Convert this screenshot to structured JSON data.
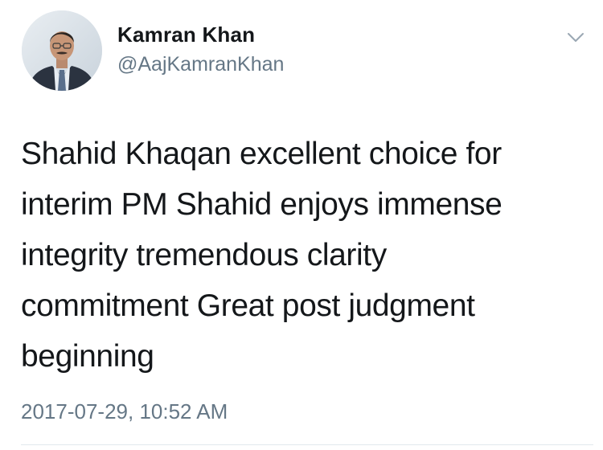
{
  "tweet": {
    "author_name": "Kamran Khan",
    "author_handle": "@AajKamranKhan",
    "text": "Shahid Khaqan excellent choice for\ninterim PM Shahid enjoys immense\nintegrity tremendous clarity\ncommitment Great post judgment\nbeginning",
    "timestamp": "2017-07-29, 10:52 AM",
    "menu_icon": "chevron-down-icon"
  },
  "colors": {
    "text_primary": "#14171a",
    "text_secondary": "#657786",
    "divider": "#e1e8ed",
    "background": "#ffffff"
  }
}
